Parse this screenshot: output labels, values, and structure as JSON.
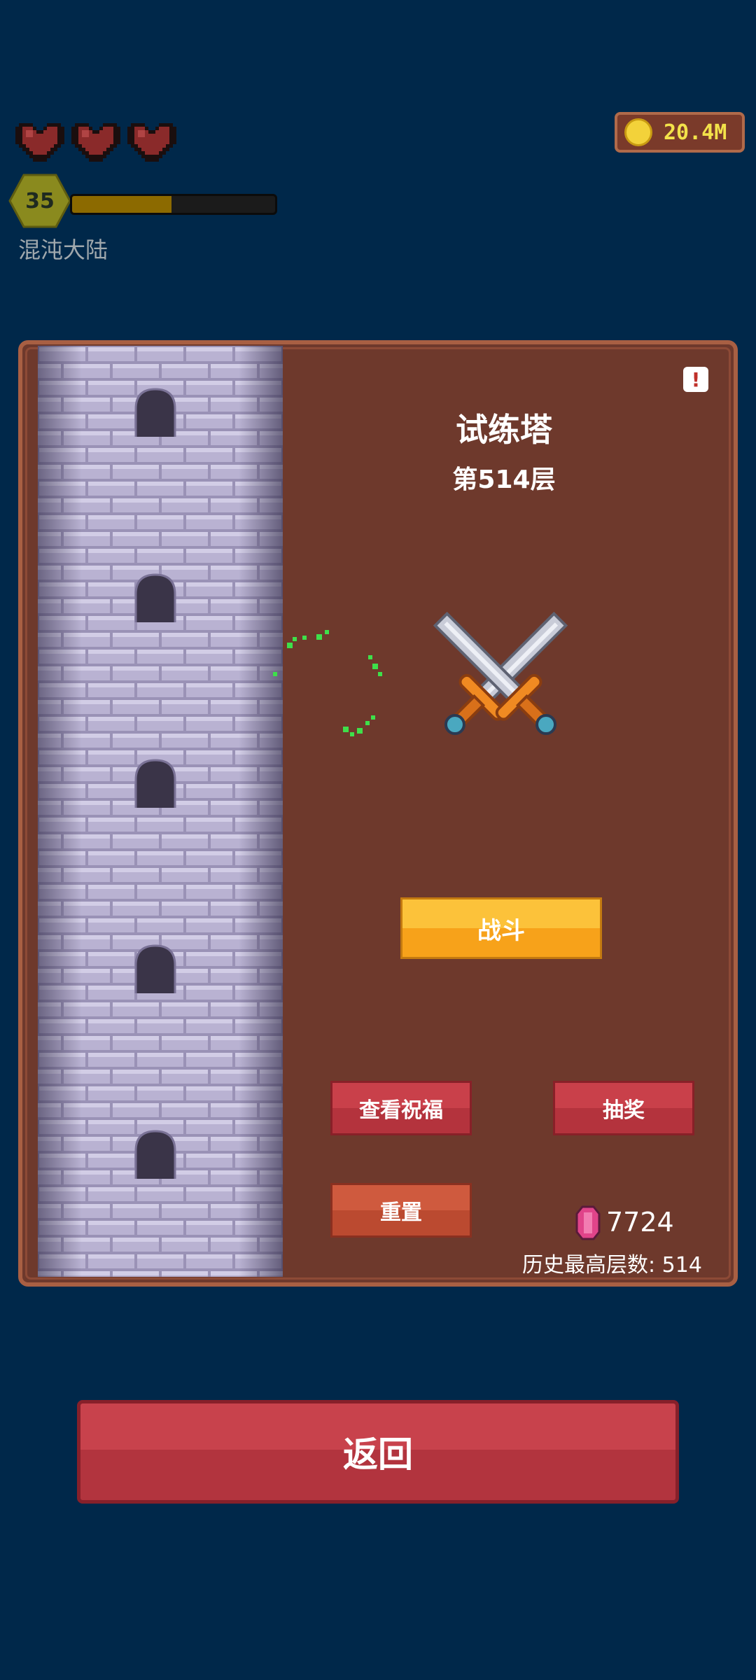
{
  "hud": {
    "hearts": 3,
    "level": "35",
    "xp_fraction": 0.49,
    "region": "混沌大陆",
    "coins": "20.4M"
  },
  "panel": {
    "alert_symbol": "!",
    "title": "试练塔",
    "floor": "第514层",
    "fight_button": "战斗",
    "bless_button": "查看祝福",
    "lottery_button": "抽奖",
    "reset_button": "重置",
    "gems": "7724",
    "best_floor": "历史最高层数: 514"
  },
  "footer": {
    "back_button": "返回"
  },
  "colors": {
    "background": "#00284a",
    "panel": "#6e392c",
    "panel_border": "#a85f43",
    "fight": "#f7a21a",
    "red_button": "#b4333d"
  }
}
